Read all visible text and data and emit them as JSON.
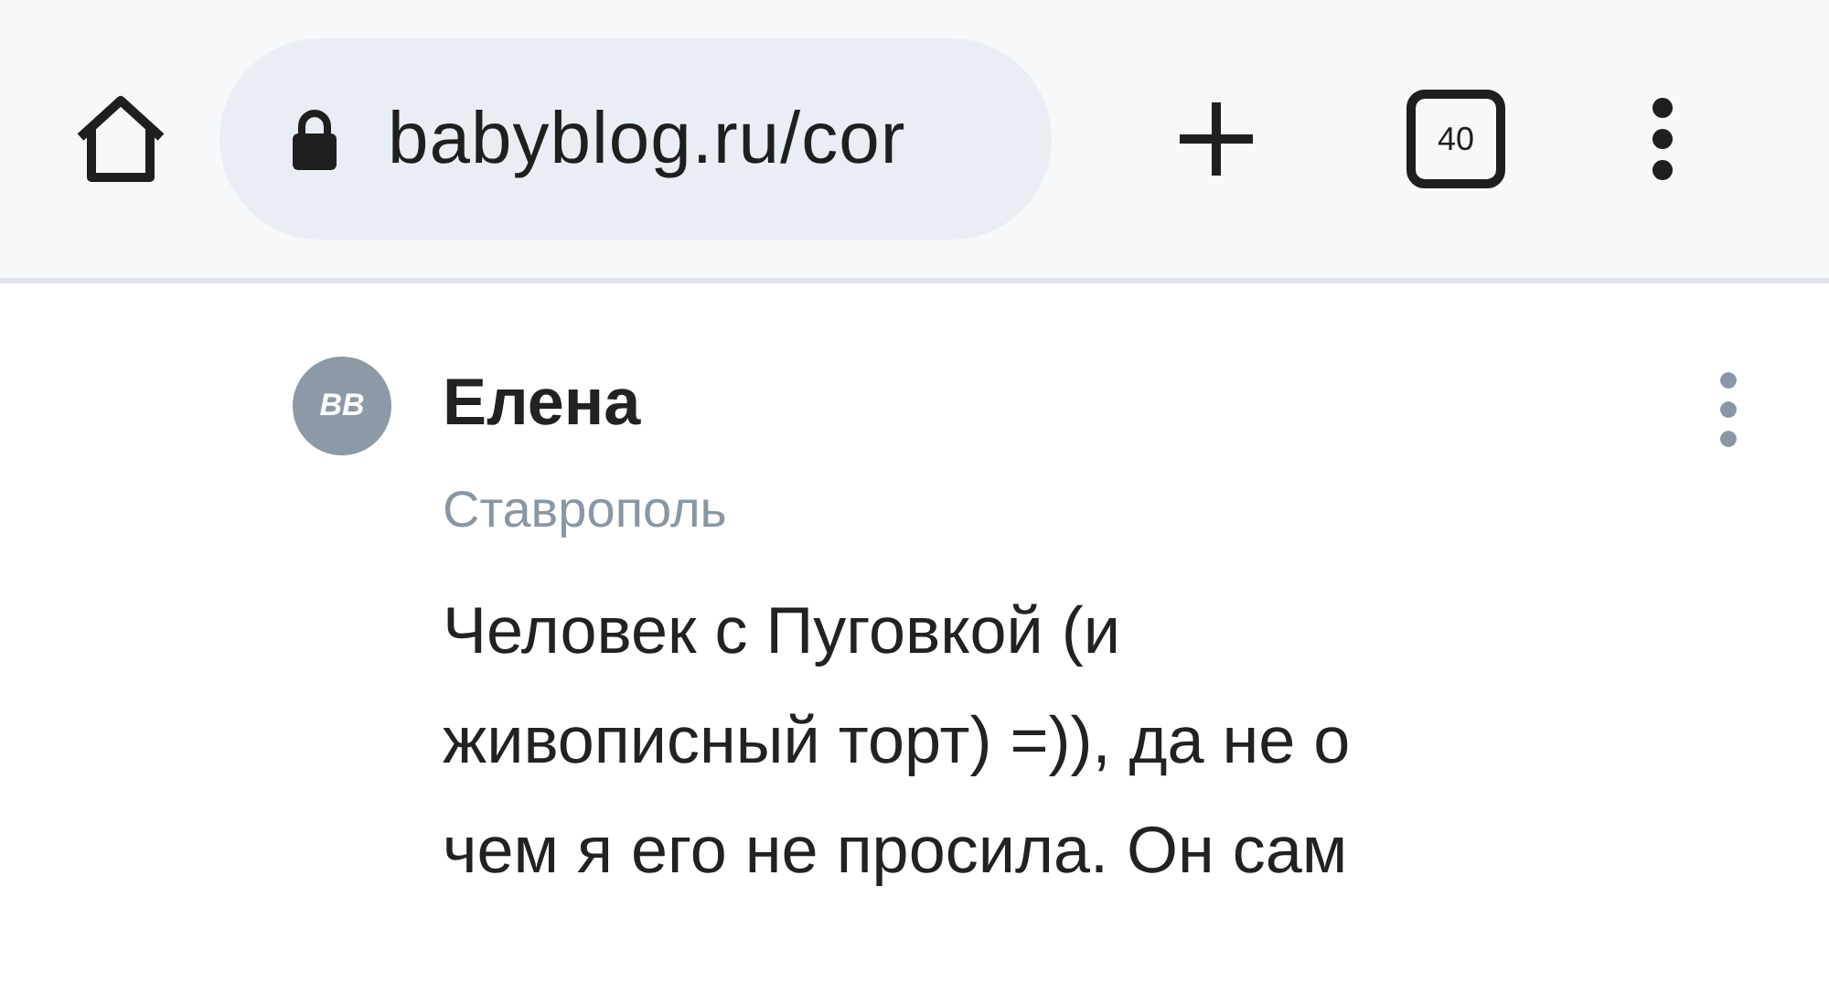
{
  "browser": {
    "url": "babyblog.ru/cor",
    "tab_count": "40"
  },
  "comment": {
    "avatar_text": "BB",
    "author": "Елена",
    "city": "Ставрополь",
    "text": "Человек с Пуговкой (и\nживописный торт) =)), да не о\nчем я его не просила. Он сам"
  }
}
